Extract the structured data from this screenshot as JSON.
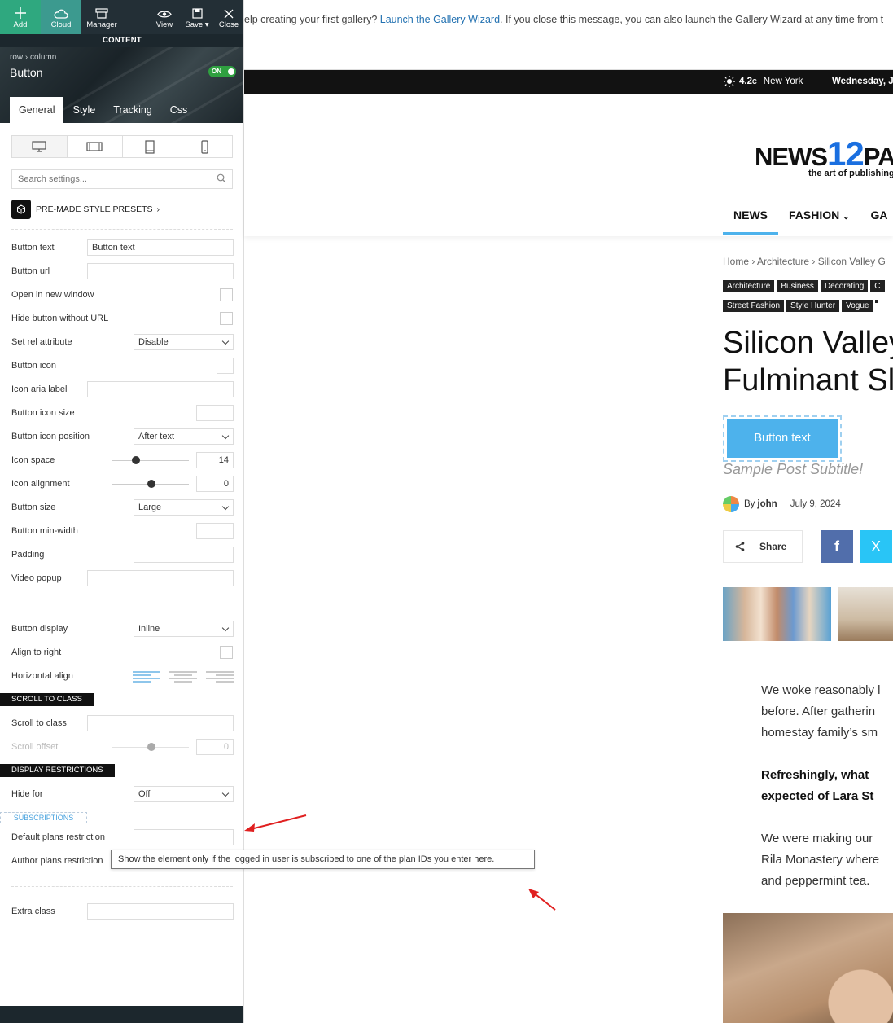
{
  "toolbar": {
    "add": "Add",
    "cloud": "Cloud",
    "manager": "Manager",
    "view": "View",
    "save": "Save",
    "close": "Close",
    "content_tab": "CONTENT"
  },
  "element": {
    "breadcrumb_row": "row",
    "breadcrumb_sep": "›",
    "breadcrumb_column": "column",
    "title": "Button",
    "toggle": "ON"
  },
  "tabs": [
    "General",
    "Style",
    "Tracking",
    "Css"
  ],
  "search": {
    "placeholder": "Search settings..."
  },
  "presets": {
    "label": "PRE-MADE STYLE PRESETS",
    "chevron": "›"
  },
  "settings": {
    "button_text_label": "Button text",
    "button_text_value": "Button text",
    "button_url_label": "Button url",
    "open_new_window_label": "Open in new window",
    "hide_without_url_label": "Hide button without URL",
    "rel_label": "Set rel attribute",
    "rel_value": "Disable",
    "icon_label": "Button icon",
    "icon_aria_label": "Icon aria label",
    "icon_size_label": "Button icon size",
    "icon_position_label": "Button icon position",
    "icon_position_value": "After text",
    "icon_space_label": "Icon space",
    "icon_space_value": "14",
    "icon_alignment_label": "Icon alignment",
    "icon_alignment_value": "0",
    "button_size_label": "Button size",
    "button_size_value": "Large",
    "min_width_label": "Button min-width",
    "padding_label": "Padding",
    "video_popup_label": "Video popup",
    "display_label": "Button display",
    "display_value": "Inline",
    "align_right_label": "Align to right",
    "horizontal_align_label": "Horizontal align"
  },
  "scroll_section": {
    "header": "SCROLL TO CLASS",
    "class_label": "Scroll to class",
    "offset_label": "Scroll offset",
    "offset_value": "0"
  },
  "restrictions": {
    "header": "DISPLAY RESTRICTIONS",
    "hide_for_label": "Hide for",
    "hide_for_value": "Off",
    "subscriptions_header": "SUBSCRIPTIONS",
    "default_plans_label": "Default plans restriction",
    "author_plans_label": "Author plans restriction",
    "tooltip": "Show the element only if the logged in user is subscribed to one of the plan IDs you enter here."
  },
  "extra_class_label": "Extra class",
  "notice": {
    "text_before": "elp creating your first gallery? ",
    "link": "Launch the Gallery Wizard",
    "text_after": ". If you close this message, you can also launch the Gallery Wizard at any time from t"
  },
  "topbar_site": {
    "temp": "4.2",
    "temp_unit": "C",
    "city": "New York",
    "date": "Wednesday, Ju"
  },
  "site": {
    "logo_a": "NEWS",
    "logo_b": "12",
    "logo_c": "PA",
    "tagline": "the art of publishing",
    "menu": [
      "NEWS",
      "FASHION",
      "GA"
    ]
  },
  "article": {
    "breadcrumb": "Home › Architecture › Silicon Valley G",
    "categories": [
      "Architecture",
      "Business",
      "Decorating",
      "C",
      "Street Fashion",
      "Style Hunter",
      "Vogue",
      ""
    ],
    "title_line1": "Silicon Valley",
    "title_line2": "Fulminant Sl",
    "button": "Button text",
    "subtitle": "Sample Post Subtitle!",
    "by": "By",
    "author": "john",
    "date": "July 9, 2024",
    "share": "Share",
    "fb": "f",
    "tw": "X",
    "p1_l1": "We woke reasonably l",
    "p1_l2": "before. After gatherin",
    "p1_l3": "homestay family’s sm",
    "p2_l1": "Refreshingly, what",
    "p2_l2": "expected of Lara St",
    "p3_l1": "We were making our",
    "p3_l2": "Rila Monastery where",
    "p3_l3": "and peppermint tea."
  },
  "colors": {
    "accent": "#4db2ec",
    "toolbar_green": "#2fa87f",
    "toolbar_dark": "#232f36",
    "annotation_red": "#e02020"
  }
}
